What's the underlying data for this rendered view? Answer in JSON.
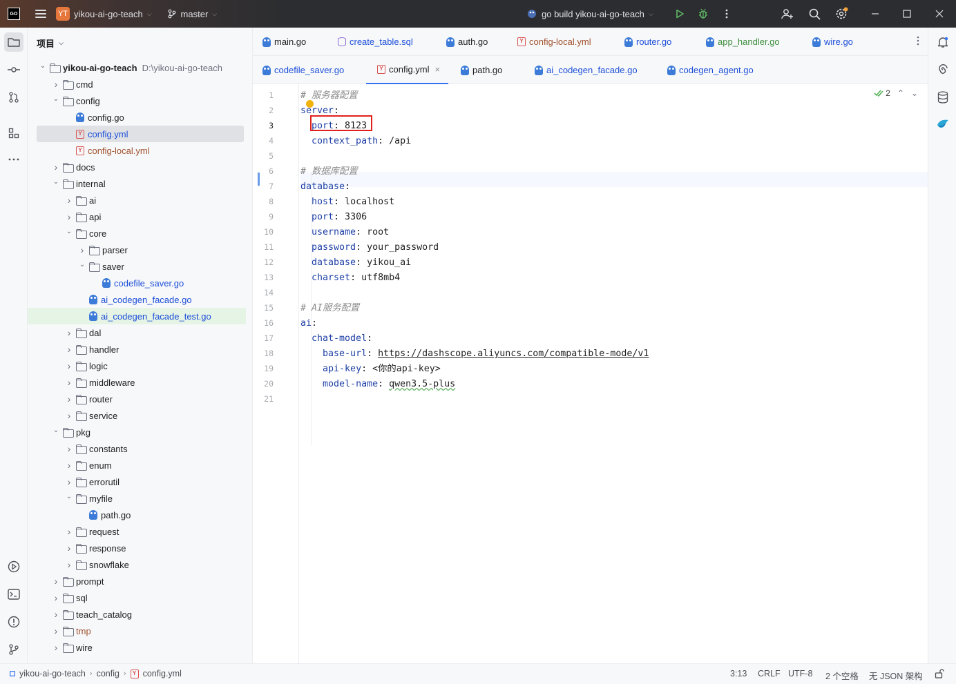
{
  "titlebar": {
    "logo_text": "GO",
    "project_badge": "YT",
    "project_name": "yikou-ai-go-teach",
    "branch": "master",
    "run_config": "go build yikou-ai-go-teach"
  },
  "project_panel": {
    "title": "项目",
    "tree": [
      {
        "label": "yikou-ai-go-teach",
        "hint": "D:\\yikou-ai-go-teach",
        "type": "folder",
        "depth": 0,
        "expanded": true
      },
      {
        "label": "cmd",
        "type": "folder",
        "depth": 1,
        "expanded": false
      },
      {
        "label": "config",
        "type": "folder",
        "depth": 1,
        "expanded": true
      },
      {
        "label": "config.go",
        "type": "go",
        "depth": 2
      },
      {
        "label": "config.yml",
        "type": "yml",
        "depth": 2,
        "state": "selected"
      },
      {
        "label": "config-local.yml",
        "type": "yml",
        "depth": 2,
        "color": "brown"
      },
      {
        "label": "docs",
        "type": "folder",
        "depth": 1,
        "expanded": false
      },
      {
        "label": "internal",
        "type": "folder",
        "depth": 1,
        "expanded": true
      },
      {
        "label": "ai",
        "type": "folder",
        "depth": 2,
        "expanded": false
      },
      {
        "label": "api",
        "type": "folder",
        "depth": 2,
        "expanded": false
      },
      {
        "label": "core",
        "type": "folder",
        "depth": 2,
        "expanded": true
      },
      {
        "label": "parser",
        "type": "folder",
        "depth": 3,
        "expanded": false
      },
      {
        "label": "saver",
        "type": "folder",
        "depth": 3,
        "expanded": true
      },
      {
        "label": "codefile_saver.go",
        "type": "go",
        "depth": 4,
        "color": "blue"
      },
      {
        "label": "ai_codegen_facade.go",
        "type": "go",
        "depth": 3,
        "color": "blue"
      },
      {
        "label": "ai_codegen_facade_test.go",
        "type": "go",
        "depth": 3,
        "color": "blue",
        "state": "highlight"
      },
      {
        "label": "dal",
        "type": "folder",
        "depth": 2,
        "expanded": false
      },
      {
        "label": "handler",
        "type": "folder",
        "depth": 2,
        "expanded": false
      },
      {
        "label": "logic",
        "type": "folder",
        "depth": 2,
        "expanded": false
      },
      {
        "label": "middleware",
        "type": "folder",
        "depth": 2,
        "expanded": false
      },
      {
        "label": "router",
        "type": "folder",
        "depth": 2,
        "expanded": false
      },
      {
        "label": "service",
        "type": "folder",
        "depth": 2,
        "expanded": false
      },
      {
        "label": "pkg",
        "type": "folder",
        "depth": 1,
        "expanded": true
      },
      {
        "label": "constants",
        "type": "folder",
        "depth": 2,
        "expanded": false
      },
      {
        "label": "enum",
        "type": "folder",
        "depth": 2,
        "expanded": false
      },
      {
        "label": "errorutil",
        "type": "folder",
        "depth": 2,
        "expanded": false
      },
      {
        "label": "myfile",
        "type": "folder",
        "depth": 2,
        "expanded": true
      },
      {
        "label": "path.go",
        "type": "go",
        "depth": 3
      },
      {
        "label": "request",
        "type": "folder",
        "depth": 2,
        "expanded": false
      },
      {
        "label": "response",
        "type": "folder",
        "depth": 2,
        "expanded": false
      },
      {
        "label": "snowflake",
        "type": "folder",
        "depth": 2,
        "expanded": false
      },
      {
        "label": "prompt",
        "type": "folder",
        "depth": 1,
        "expanded": false
      },
      {
        "label": "sql",
        "type": "folder",
        "depth": 1,
        "expanded": false
      },
      {
        "label": "teach_catalog",
        "type": "folder",
        "depth": 1,
        "expanded": false
      },
      {
        "label": "tmp",
        "type": "folder",
        "depth": 1,
        "expanded": false,
        "color": "brown"
      },
      {
        "label": "wire",
        "type": "folder",
        "depth": 1,
        "expanded": false
      }
    ]
  },
  "tabs_row1": [
    {
      "label": "main.go",
      "icon": "go"
    },
    {
      "label": "create_table.sql",
      "icon": "sql",
      "color": "blue"
    },
    {
      "label": "auth.go",
      "icon": "go"
    },
    {
      "label": "config-local.yml",
      "icon": "yml",
      "color": "brown"
    },
    {
      "label": "router.go",
      "icon": "go",
      "color": "blue"
    },
    {
      "label": "app_handler.go",
      "icon": "go",
      "color": "green"
    },
    {
      "label": "wire.go",
      "icon": "go",
      "color": "blue"
    }
  ],
  "tabs_row2": [
    {
      "label": "codefile_saver.go",
      "icon": "go",
      "color": "blue"
    },
    {
      "label": "config.yml",
      "icon": "yml",
      "active": true,
      "close": "×"
    },
    {
      "label": "path.go",
      "icon": "go"
    },
    {
      "label": "ai_codegen_facade.go",
      "icon": "go",
      "color": "blue"
    },
    {
      "label": "codegen_agent.go",
      "icon": "go",
      "color": "blue"
    }
  ],
  "editor": {
    "inspection_count": "2",
    "current_line": 3,
    "lines": [
      [
        {
          "t": "# 服务器配置",
          "c": "cm"
        }
      ],
      [
        {
          "t": "server",
          "c": "k"
        },
        {
          "t": ":"
        }
      ],
      [
        {
          "t": "  "
        },
        {
          "t": "port",
          "c": "k"
        },
        {
          "t": ": 8123"
        }
      ],
      [
        {
          "t": "  "
        },
        {
          "t": "context_path",
          "c": "k"
        },
        {
          "t": ": /api"
        }
      ],
      [],
      [
        {
          "t": "# 数据库配置",
          "c": "cm"
        }
      ],
      [
        {
          "t": "database",
          "c": "k"
        },
        {
          "t": ":"
        }
      ],
      [
        {
          "t": "  "
        },
        {
          "t": "host",
          "c": "k"
        },
        {
          "t": ": localhost"
        }
      ],
      [
        {
          "t": "  "
        },
        {
          "t": "port",
          "c": "k"
        },
        {
          "t": ": 3306"
        }
      ],
      [
        {
          "t": "  "
        },
        {
          "t": "username",
          "c": "k"
        },
        {
          "t": ": root"
        }
      ],
      [
        {
          "t": "  "
        },
        {
          "t": "password",
          "c": "k"
        },
        {
          "t": ": your_password"
        }
      ],
      [
        {
          "t": "  "
        },
        {
          "t": "database",
          "c": "k"
        },
        {
          "t": ": yikou_ai"
        }
      ],
      [
        {
          "t": "  "
        },
        {
          "t": "charset",
          "c": "k"
        },
        {
          "t": ": utf8mb4"
        }
      ],
      [],
      [
        {
          "t": "# AI服务配置",
          "c": "cm"
        }
      ],
      [
        {
          "t": "ai",
          "c": "k"
        },
        {
          "t": ":"
        }
      ],
      [
        {
          "t": "  "
        },
        {
          "t": "chat-model",
          "c": "k"
        },
        {
          "t": ":"
        }
      ],
      [
        {
          "t": "    "
        },
        {
          "t": "base-url",
          "c": "k"
        },
        {
          "t": ": "
        },
        {
          "t": "https://dashscope.aliyuncs.com/compatible-mode/v1",
          "c": "url"
        }
      ],
      [
        {
          "t": "    "
        },
        {
          "t": "api-key",
          "c": "k"
        },
        {
          "t": ": <你的api-key>"
        }
      ],
      [
        {
          "t": "    "
        },
        {
          "t": "model-name",
          "c": "k"
        },
        {
          "t": ": "
        },
        {
          "t": "qwen3.5-plus",
          "c": "squig"
        }
      ],
      []
    ]
  },
  "statusbar": {
    "crumbs": [
      "yikou-ai-go-teach",
      "config",
      "config.yml"
    ],
    "position": "3:13",
    "line_sep": "CRLF",
    "encoding": "UTF-8",
    "indent": "2 个空格",
    "schema": "无 JSON 架构"
  }
}
